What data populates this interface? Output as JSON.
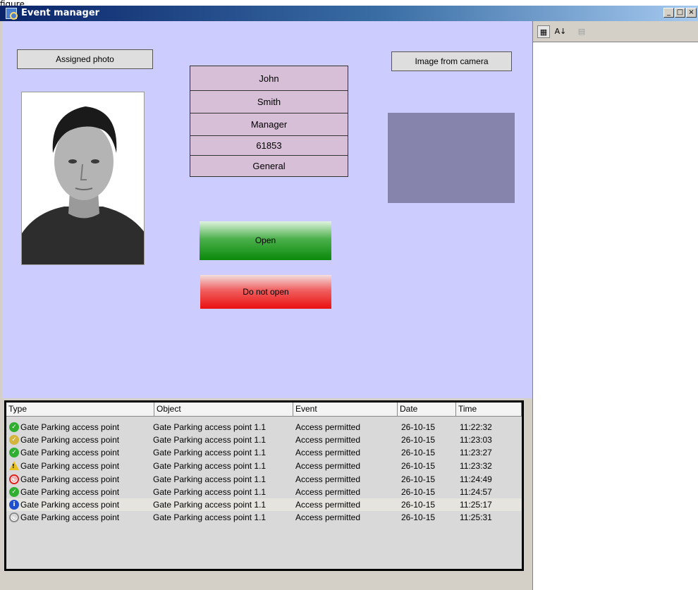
{
  "caption": "figure.",
  "window": {
    "title": "Event manager",
    "minimize": "_",
    "maximize": "□",
    "close": "×"
  },
  "panel": {
    "assigned_photo_label": "Assigned photo",
    "image_from_camera_label": "Image from camera",
    "person": {
      "first_name": "John",
      "last_name": "Smith",
      "position": "Manager",
      "id": "61853",
      "department": "General"
    },
    "open_label": "Open",
    "do_not_open_label": "Do not open"
  },
  "sidebar": {
    "categorized": "▦",
    "sort_az": "A↓",
    "pages": "▤"
  },
  "events": {
    "columns": [
      "Type",
      "Object",
      "Event",
      "Date",
      "Time"
    ],
    "rows": [
      {
        "icon": "check-icon",
        "color": "#2fae2f",
        "glyph": "✓",
        "type": "Gate Parking access point",
        "object": "Gate Parking access point 1.1",
        "event": "Access permitted",
        "date": "26-10-15",
        "time": "11:22:32"
      },
      {
        "icon": "check-icon",
        "color": "#d4b43a",
        "glyph": "✓",
        "type": "Gate Parking access point",
        "object": "Gate Parking access point 1.1",
        "event": "Access permitted",
        "date": "26-10-15",
        "time": "11:23:03"
      },
      {
        "icon": "check-icon",
        "color": "#2fae2f",
        "glyph": "✓",
        "type": "Gate Parking access point",
        "object": "Gate Parking access point 1.1",
        "event": "Access permitted",
        "date": "26-10-15",
        "time": "11:23:27"
      },
      {
        "icon": "warning-icon",
        "color": "#e8c020",
        "glyph": "!",
        "type": "Gate Parking access point",
        "object": "Gate Parking access point 1.1",
        "event": "Access permitted",
        "date": "26-10-15",
        "time": "11:23:32"
      },
      {
        "icon": "alarm-clock-icon",
        "color": "#e02020",
        "glyph": "◷",
        "type": "Gate Parking access point",
        "object": "Gate Parking access point 1.1",
        "event": "Access permitted",
        "date": "26-10-15",
        "time": "11:24:49"
      },
      {
        "icon": "check-icon",
        "color": "#2fae2f",
        "glyph": "✓",
        "type": "Gate Parking access point",
        "object": "Gate Parking access point 1.1",
        "event": "Access permitted",
        "date": "26-10-15",
        "time": "11:24:57"
      },
      {
        "icon": "info-icon",
        "color": "#2050d0",
        "glyph": "i",
        "type": "Gate Parking access point",
        "object": "Gate Parking access point 1.1",
        "event": "Access permitted",
        "date": "26-10-15",
        "time": "11:25:17"
      },
      {
        "icon": "clock-icon",
        "color": "#8a8a8a",
        "glyph": "◷",
        "type": "Gate Parking access point",
        "object": "Gate Parking access point 1.1",
        "event": "Access permitted",
        "date": "26-10-15",
        "time": "11:25:31"
      }
    ]
  }
}
